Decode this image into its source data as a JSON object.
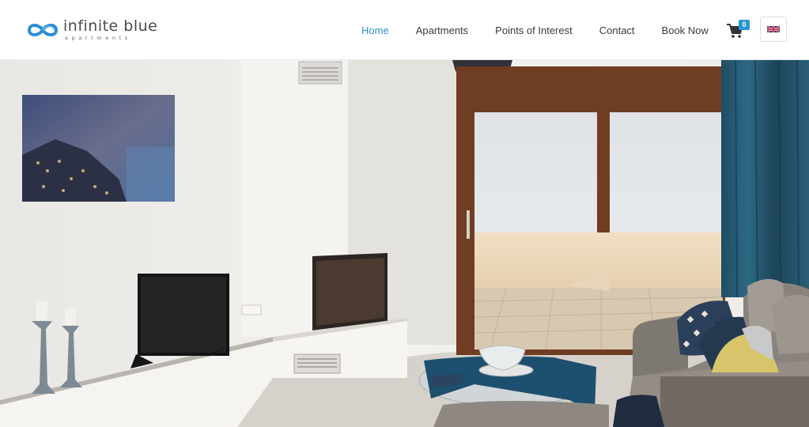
{
  "brand": {
    "name": "infinite blue",
    "tagline": "apartments",
    "logo_color": "#2a8fd4"
  },
  "nav": {
    "items": [
      {
        "label": "Home",
        "active": true
      },
      {
        "label": "Apartments",
        "active": false
      },
      {
        "label": "Points of Interest",
        "active": false
      },
      {
        "label": "Contact",
        "active": false
      },
      {
        "label": "Book Now",
        "active": false
      }
    ],
    "active_color": "#2f8fce"
  },
  "cart": {
    "icon": "shopping-cart-icon",
    "count": "0"
  },
  "language": {
    "icon": "uk-flag-icon"
  },
  "hero": {
    "image": "apartment-living-room-photo"
  }
}
